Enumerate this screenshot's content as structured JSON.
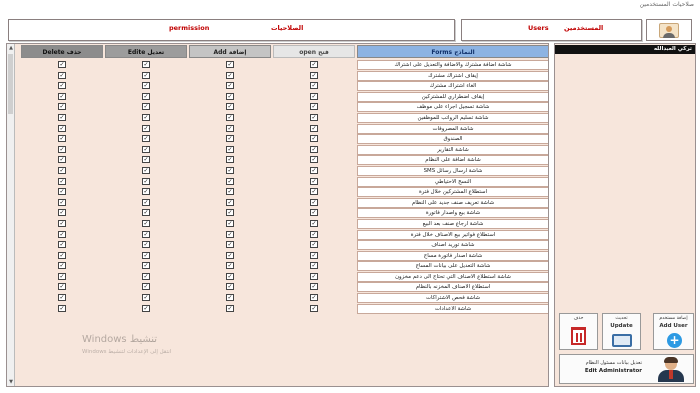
{
  "window": {
    "title": "صلاحيات المستخدمين"
  },
  "header": {
    "permission_label": "permission",
    "permission_label_ar": "الصلاحيات",
    "users_label": "Users",
    "users_label_ar": "المستخدمين"
  },
  "grid": {
    "columns": {
      "delete": "Delete حذف",
      "edit": "Edite تعديل",
      "add": "Add إضافة",
      "open": "open فتح",
      "forms": "Forms النماذج"
    },
    "rows": [
      {
        "name": "شاشة اضافة مشترك والاضافة والتعديل على اشتراك",
        "delete": true,
        "edit": true,
        "add": true,
        "open": true
      },
      {
        "name": "إيقاف اشتراك مشترك",
        "delete": true,
        "edit": true,
        "add": true,
        "open": true
      },
      {
        "name": "الغاء اشتراك مشترك",
        "delete": true,
        "edit": true,
        "add": true,
        "open": true
      },
      {
        "name": "إيقاف اضطراري للمشتركين",
        "delete": true,
        "edit": true,
        "add": true,
        "open": true
      },
      {
        "name": "شاشة تسجيل اجراء على موظف",
        "delete": true,
        "edit": true,
        "add": true,
        "open": true
      },
      {
        "name": "شاشة تسليم الرواتب للموظفين",
        "delete": true,
        "edit": true,
        "add": true,
        "open": true
      },
      {
        "name": "شاشة المصروفات",
        "delete": true,
        "edit": true,
        "add": true,
        "open": true
      },
      {
        "name": "الصندوق",
        "delete": true,
        "edit": true,
        "add": true,
        "open": true
      },
      {
        "name": "شاشة التقارير",
        "delete": true,
        "edit": true,
        "add": true,
        "open": true
      },
      {
        "name": "شاشة اضافة على النظام",
        "delete": true,
        "edit": true,
        "add": true,
        "open": true
      },
      {
        "name": "شاشة ارسال رسائل SMS",
        "delete": true,
        "edit": true,
        "add": true,
        "open": true
      },
      {
        "name": "النسخ الاحتياطي",
        "delete": true,
        "edit": true,
        "add": true,
        "open": true
      },
      {
        "name": "استطلاع المشتركين خلال فترة",
        "delete": true,
        "edit": true,
        "add": true,
        "open": true
      },
      {
        "name": "شاشة تعريف صنف جديد على النظام",
        "delete": true,
        "edit": true,
        "add": true,
        "open": true
      },
      {
        "name": "شاشة بيع واصدار فاتورة",
        "delete": true,
        "edit": true,
        "add": true,
        "open": true
      },
      {
        "name": "شاشة ارجاع صنف بعد البيع",
        "delete": true,
        "edit": true,
        "add": true,
        "open": true
      },
      {
        "name": "استطلاع فواتير بيع الاصناف خلال فترة",
        "delete": true,
        "edit": true,
        "add": true,
        "open": true
      },
      {
        "name": "شاشة توريد اصناف",
        "delete": true,
        "edit": true,
        "add": true,
        "open": true
      },
      {
        "name": "شاشة اصدار فاتورة مساج",
        "delete": true,
        "edit": true,
        "add": true,
        "open": true
      },
      {
        "name": "شاشة التعديل على بيانات المساج",
        "delete": true,
        "edit": true,
        "add": true,
        "open": true
      },
      {
        "name": "شاشة استطلاع الاصناف التي تحتاج الى دعم مخزون",
        "delete": true,
        "edit": true,
        "add": true,
        "open": true
      },
      {
        "name": "استطلاع الاصناف المخزنه بالنظام",
        "delete": true,
        "edit": true,
        "add": true,
        "open": true
      },
      {
        "name": "شاشة فحص الاشتراكات",
        "delete": true,
        "edit": true,
        "add": true,
        "open": true
      },
      {
        "name": "شاشة الاعدادات",
        "delete": true,
        "edit": true,
        "add": true,
        "open": true
      }
    ]
  },
  "users": {
    "selected_user": "تركي العبدالله"
  },
  "actions": {
    "delete_ar": "حذف",
    "update_ar": "تحديث",
    "update_en": "Update",
    "add_ar": "إضافة مستخدم",
    "add_en": "Add User",
    "edit_admin_ar": "تعديل بيانات مسئول النظام",
    "edit_admin_en": "Edit Administrator"
  },
  "overlay": {
    "watermark_line1": "Windows تنشيط",
    "watermark_line2": "انتقل إلى الإعدادات لتنشيط Windows"
  }
}
